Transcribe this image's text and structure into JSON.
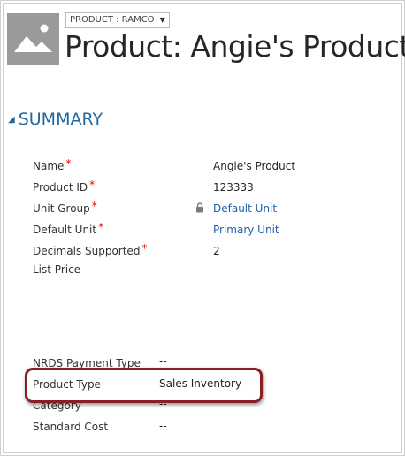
{
  "header": {
    "form_selector": {
      "label": "PRODUCT : RAMCO",
      "icon": "chevron-down-icon"
    },
    "title": "Product: Angie's Product",
    "thumbnail_icon": "image-placeholder-icon"
  },
  "summary": {
    "title": "SUMMARY",
    "fields": {
      "name": {
        "label": "Name",
        "required": "*",
        "value": "Angie's Product"
      },
      "product_id": {
        "label": "Product ID",
        "required": "*",
        "value": "123333"
      },
      "unit_group": {
        "label": "Unit Group",
        "required": "*",
        "value": "Default Unit"
      },
      "default_unit": {
        "label": "Default Unit",
        "required": "*",
        "value": "Primary Unit"
      },
      "decimals_supported": {
        "label": "Decimals Supported",
        "required": "*",
        "value": "2"
      },
      "list_price": {
        "label": "List Price",
        "value": "--"
      },
      "nrds_payment_type": {
        "label": "NRDS Payment Type",
        "value": "--"
      },
      "product_type": {
        "label": "Product Type",
        "value": "Sales Inventory"
      },
      "category": {
        "label": "Category",
        "value": "--"
      },
      "standard_cost": {
        "label": "Standard Cost",
        "value": "--"
      }
    }
  },
  "colors": {
    "section_header": "#1f67a3",
    "link": "#1f5fa8",
    "required": "#ee0000",
    "highlight": "#8b1e24"
  }
}
